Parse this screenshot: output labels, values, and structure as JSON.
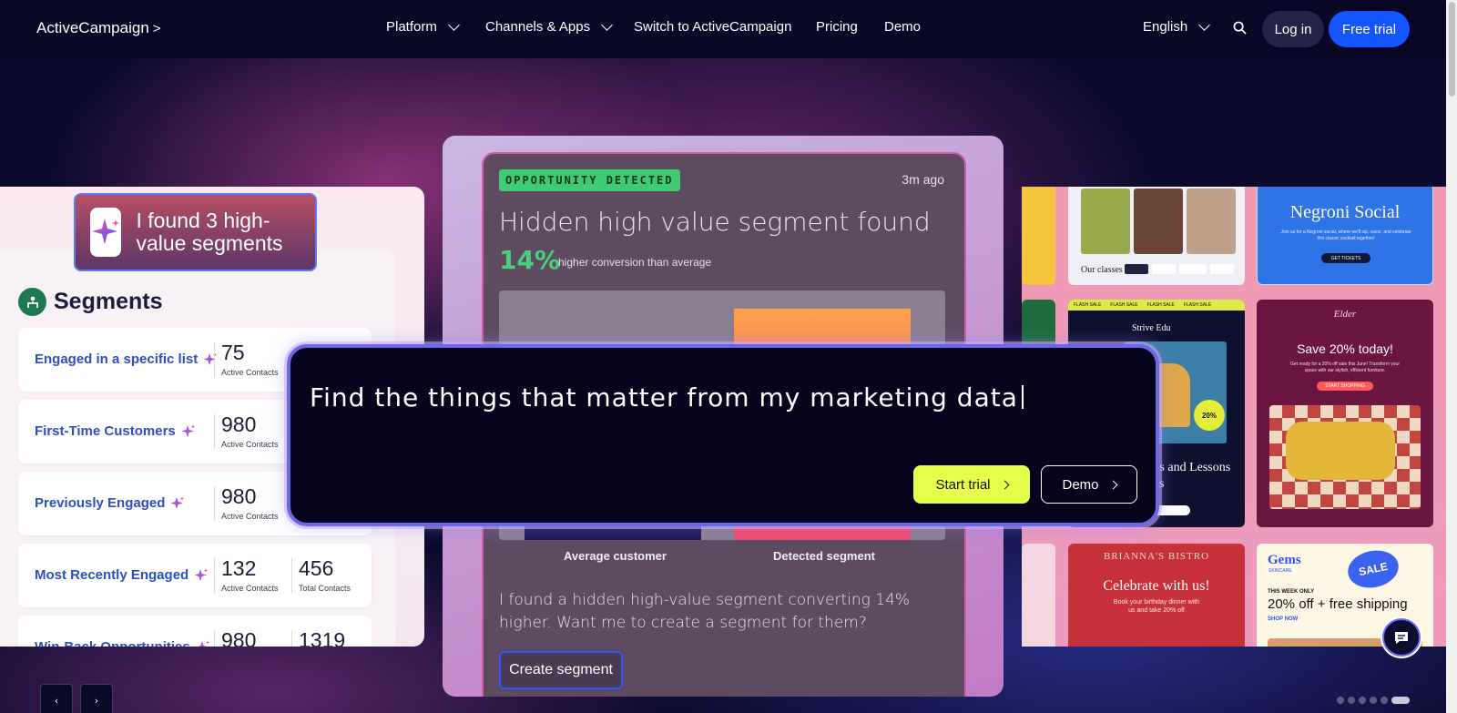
{
  "nav": {
    "logo": "ActiveCampaign",
    "items": [
      {
        "label": "Platform",
        "has_caret": true
      },
      {
        "label": "Channels & Apps",
        "has_caret": true
      },
      {
        "label": "Switch to ActiveCampaign",
        "has_caret": false
      },
      {
        "label": "Pricing",
        "has_caret": false
      },
      {
        "label": "Demo",
        "has_caret": false
      }
    ],
    "language": "English",
    "login": "Log in",
    "free_trial": "Free trial"
  },
  "left": {
    "callout": "I found 3 high-value segments",
    "segments_title": "Segments",
    "rows": [
      {
        "name": "Engaged in a specific list",
        "active": "75",
        "active_label": "Active Contacts",
        "total": "",
        "total_label": ""
      },
      {
        "name": "First-Time Customers",
        "active": "980",
        "active_label": "Active Contacts",
        "total": "",
        "total_label": ""
      },
      {
        "name": "Previously Engaged",
        "active": "980",
        "active_label": "Active Contacts",
        "total": "",
        "total_label": ""
      },
      {
        "name": "Most Recently Engaged",
        "active": "132",
        "active_label": "Active Contacts",
        "total": "456",
        "total_label": "Total Contacts"
      },
      {
        "name": "Win-Back Opportunities",
        "active": "980",
        "active_label": "",
        "total": "1319",
        "total_label": ""
      }
    ]
  },
  "card": {
    "badge": "OPPORTUNITY DETECTED",
    "time_ago": "3m ago",
    "headline": "Hidden high value segment found",
    "pct": "14%",
    "pct_sub": "higher conversion than average",
    "label_avg": "Average customer",
    "label_detected": "Detected segment",
    "body": "I found a hidden high-value segment converting 14% higher. Want me to create a segment for them?",
    "create_button": "Create segment"
  },
  "prompt": {
    "text": "Find the things that matter from my marketing data",
    "start_trial": "Start trial",
    "demo": "Demo"
  },
  "right": {
    "our_classes": "Our classes",
    "negroni_title": "Negroni Social",
    "negroni_text": "Join us for a Negroni social, where we'll sip, savor, and celebrate this classic cocktail together!",
    "get_tickets": "GET TICKETS",
    "strive": "Strive Edu",
    "flash": "FLASH SALE",
    "strive_text": "Records and Lessons for Less",
    "elder": "Elder",
    "save_text": "Save 20% today!",
    "save_sub": "Get ready for a 20% off sale this June! Transform your space with our stylish, efficient furniture.",
    "start_shopping": "START SHOPPING",
    "bistro": "BRIANNA'S BISTRO",
    "celebrate": "Celebrate with us!",
    "celebrate_sub": "Book your birthday dinner with us and take 20% off",
    "gems": "Gems",
    "gems_sub": "SKINCARE",
    "sale": "SALE",
    "this_week": "THIS WEEK ONLY",
    "offer": "20% off + free shipping",
    "shop_now": "SHOP NOW"
  },
  "carousel": {
    "prev": "‹",
    "next": "›",
    "dots": 6,
    "active_index": 5
  },
  "colors": {
    "accent_blue": "#1555ff",
    "accent_lime": "#e6ff4a",
    "nav_bg": "#080826",
    "success_green": "#3fcb74"
  }
}
